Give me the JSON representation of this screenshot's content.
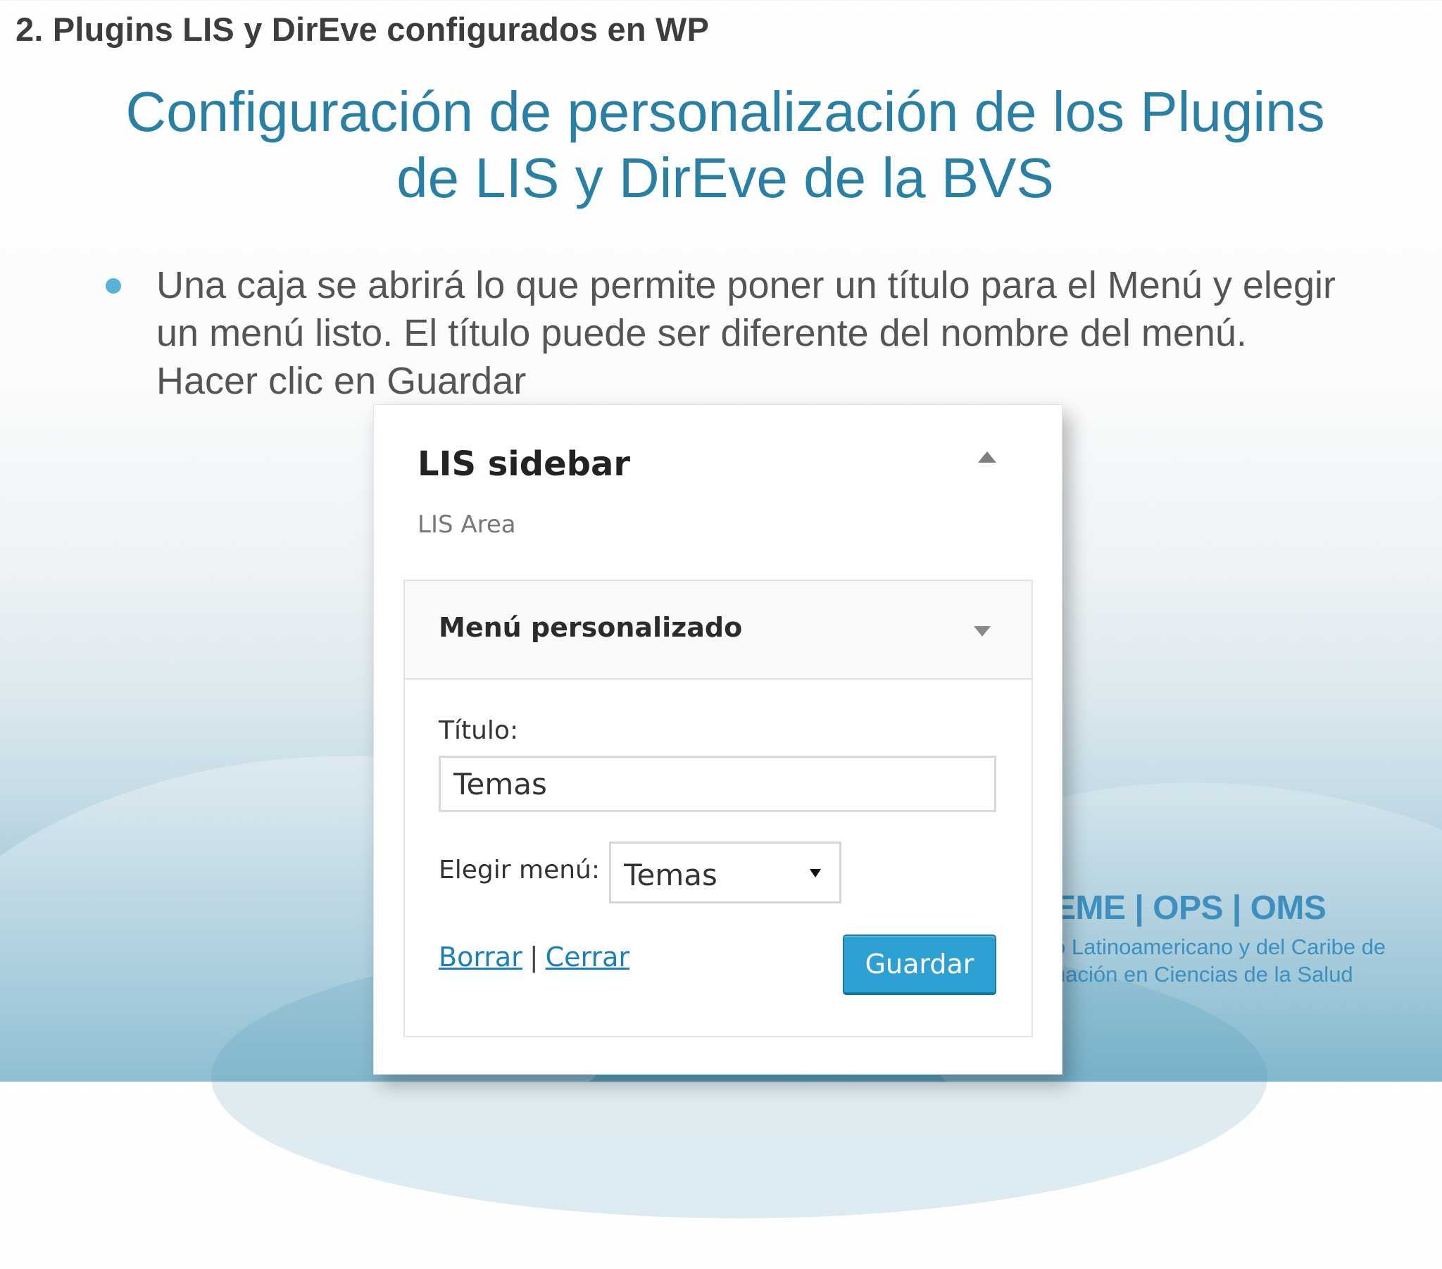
{
  "slide": {
    "section_header": "2. Plugins LIS y DirEve configurados en WP",
    "title_line1": "Configuración de personalización de los Plugins",
    "title_line2": "de LIS y DirEve de la BVS",
    "bullet_text": "Una caja se abrirá lo que permite poner un título para el Menú y elegir un menú listo. El título puede ser diferente del nombre del menú. Hacer clic en Guardar"
  },
  "logo": {
    "line1": "EME | OPS | OMS",
    "line2": "o Latinoamericano y del Caribe de",
    "line3": "nación en Ciencias de la Salud"
  },
  "widget": {
    "title": "LIS sidebar",
    "subtitle": "LIS Area",
    "inner": {
      "header_title": "Menú personalizado",
      "title_label": "Título:",
      "title_value": "Temas",
      "menu_label": "Elegir menú:",
      "menu_selected": "Temas",
      "delete_link": "Borrar",
      "separator": "|",
      "close_link": "Cerrar",
      "save_label": "Guardar"
    }
  },
  "colors": {
    "title_blue": "#2a7fa4",
    "bullet_blue": "#5ab3d6",
    "button_blue": "#2e9fd3",
    "link_blue": "#1c7fb5"
  },
  "icons": {
    "widget_collapse": "triangle-up-icon",
    "section_expand": "triangle-down-icon",
    "select_arrow": "dropdown-arrow-icon"
  }
}
